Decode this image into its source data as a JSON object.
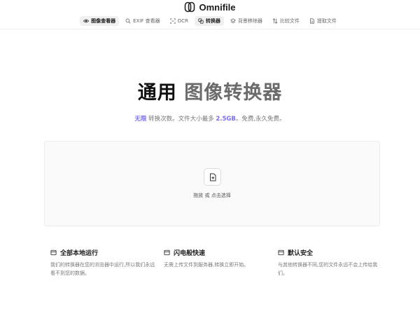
{
  "brand": {
    "name": "Omnifile"
  },
  "nav": [
    {
      "label": "图像查看器",
      "icon": "eye-icon",
      "active": true
    },
    {
      "label": "EXIF 查看器",
      "icon": "search-icon",
      "active": false
    },
    {
      "label": "OCR",
      "icon": "ocr-scan-icon",
      "active": false
    },
    {
      "label": "转换器",
      "icon": "convert-icon",
      "active": true
    },
    {
      "label": "背景移除器",
      "icon": "layers-icon",
      "active": false
    },
    {
      "label": "比较文件",
      "icon": "compare-icon",
      "active": false
    },
    {
      "label": "提取文件",
      "icon": "file-extract-icon",
      "active": false
    }
  ],
  "hero": {
    "title_strong": "通用",
    "title_muted": "图像转换器"
  },
  "subtitle": {
    "highlight1": "无限",
    "text1": " 转换次数。文件大小最多 ",
    "highlight2": "2.5GB",
    "text2": "。免费,永久免费。"
  },
  "dropzone": {
    "text": "拖放 或 点击选择"
  },
  "features": [
    {
      "title": "全部本地运行",
      "desc": "我们的转换器在您的浏览器中运行,所以我们永远看不到您的数据。"
    },
    {
      "title": "闪电般快速",
      "desc": "无需上传文件到服务器,转换立即开始。"
    },
    {
      "title": "默认安全",
      "desc": "与其他转换器不同,您的文件永远不会上传给我们。"
    }
  ],
  "colors": {
    "accent": "#7b6df0",
    "muted": "#6b6b6b"
  }
}
